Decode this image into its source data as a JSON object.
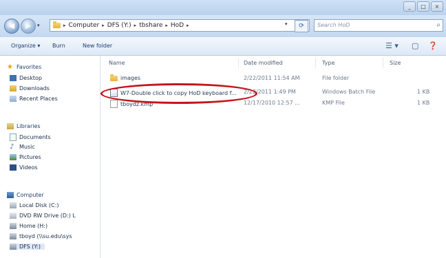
{
  "address": {
    "crumbs": [
      "Computer",
      "DFS (Y:)",
      "tbshare",
      "HoD"
    ]
  },
  "search": {
    "placeholder": "Search HoD"
  },
  "toolbar": {
    "organize": "Organize ▾",
    "burn": "Burn",
    "new_folder": "New folder"
  },
  "sidebar": {
    "favorites": "Favorites",
    "fav_items": [
      "Desktop",
      "Downloads",
      "Recent Places"
    ],
    "libraries": "Libraries",
    "lib_items": [
      "Documents",
      "Music",
      "Pictures",
      "Videos"
    ],
    "computer": "Computer",
    "comp_items": [
      "Local Disk (C:)",
      "DVD RW Drive (D:) L",
      "Home (H:)",
      "tboyd (\\\\su.edu\\sys",
      "DFS (Y:)"
    ]
  },
  "columns": {
    "name": "Name",
    "date": "Date modified",
    "type": "Type",
    "size": "Size"
  },
  "files": [
    {
      "name": "images",
      "date": "2/22/2011 11:54 AM",
      "type": "File folder",
      "size": ""
    },
    {
      "name": "W7-Double click to copy HoD keyboard f...",
      "date": "2/22/2011 1:49 PM",
      "type": "Windows Batch File",
      "size": "1 KB"
    },
    {
      "name": "tboydz.kmp",
      "date": "12/17/2010 12:57 ...",
      "type": "KMP File",
      "size": "1 KB"
    }
  ],
  "colors": {
    "highlight_oval": "#c4151c",
    "title_bar": "#c3d8f0"
  },
  "icons": [
    "back-arrow-icon",
    "forward-arrow-icon",
    "folder-icon",
    "refresh-icon",
    "search-icon",
    "star-icon",
    "batch-file-icon",
    "kmp-file-icon",
    "computer-icon",
    "drive-icon"
  ]
}
